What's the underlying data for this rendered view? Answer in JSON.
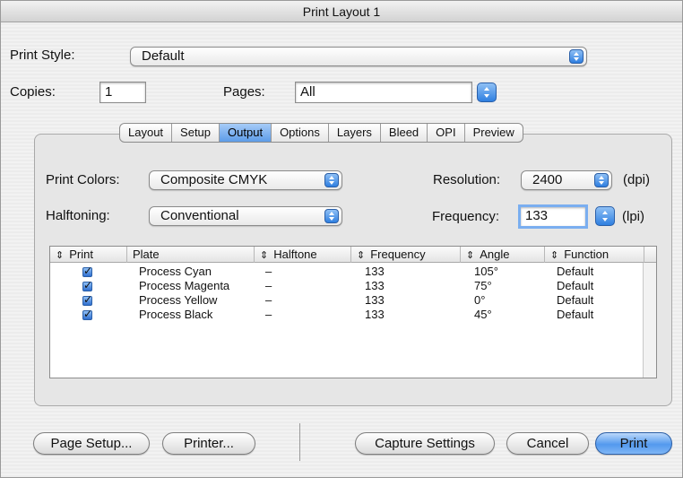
{
  "window": {
    "title": "Print Layout 1"
  },
  "print_style": {
    "label": "Print Style:",
    "value": "Default"
  },
  "copies": {
    "label": "Copies:",
    "value": "1"
  },
  "pages": {
    "label": "Pages:",
    "value": "All"
  },
  "tabs": [
    "Layout",
    "Setup",
    "Output",
    "Options",
    "Layers",
    "Bleed",
    "OPI",
    "Preview"
  ],
  "active_tab": "Output",
  "output": {
    "print_colors": {
      "label": "Print Colors:",
      "value": "Composite CMYK"
    },
    "halftoning": {
      "label": "Halftoning:",
      "value": "Conventional"
    },
    "resolution": {
      "label": "Resolution:",
      "value": "2400",
      "unit": "(dpi)"
    },
    "frequency": {
      "label": "Frequency:",
      "value": "133",
      "unit": "(lpi)"
    }
  },
  "table": {
    "sort_glyph": "⇕",
    "columns": [
      "Print",
      "Plate",
      "Halftone",
      "Frequency",
      "Angle",
      "Function"
    ],
    "rows": [
      {
        "print": true,
        "plate": "Process Cyan",
        "halftone": "–",
        "frequency": "133",
        "angle": "105°",
        "function": "Default"
      },
      {
        "print": true,
        "plate": "Process Magenta",
        "halftone": "–",
        "frequency": "133",
        "angle": "75°",
        "function": "Default"
      },
      {
        "print": true,
        "plate": "Process Yellow",
        "halftone": "–",
        "frequency": "133",
        "angle": "0°",
        "function": "Default"
      },
      {
        "print": true,
        "plate": "Process Black",
        "halftone": "–",
        "frequency": "133",
        "angle": "45°",
        "function": "Default"
      }
    ]
  },
  "buttons": {
    "page_setup": "Page Setup...",
    "printer": "Printer...",
    "capture_settings": "Capture Settings",
    "cancel": "Cancel",
    "print": "Print"
  },
  "colors": {
    "accent": "#5d9ce8",
    "default_button": "#5399ee"
  }
}
